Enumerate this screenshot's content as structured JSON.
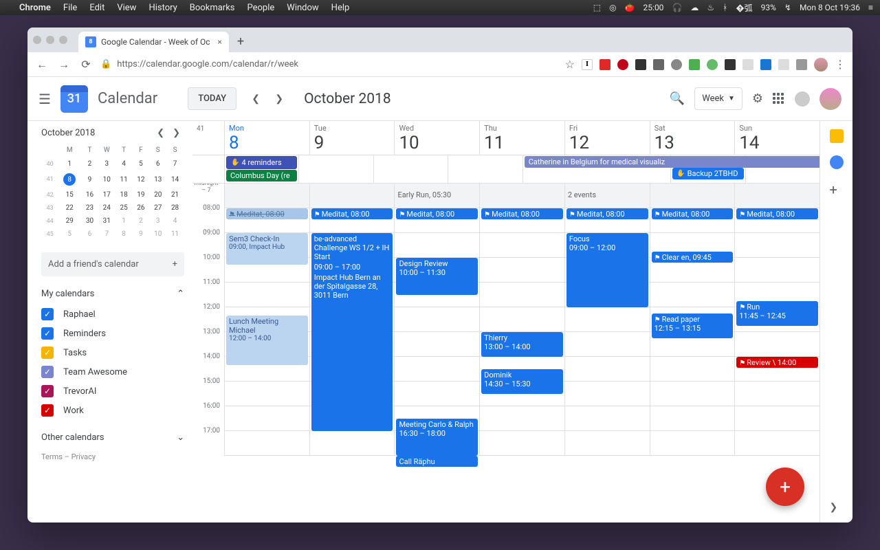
{
  "menubar": {
    "app": "Chrome",
    "items": [
      "File",
      "Edit",
      "View",
      "History",
      "Bookmarks",
      "People",
      "Window",
      "Help"
    ],
    "timer": "25:00",
    "battery": "93%",
    "clock": "Mon 8 Oct 19:36"
  },
  "tab": {
    "title": "Google Calendar - Week of Oc"
  },
  "url": "https://calendar.google.com/calendar/r/week",
  "header": {
    "logo_day": "31",
    "title": "Calendar",
    "today": "TODAY",
    "month": "October 2018",
    "view": "Week"
  },
  "minical": {
    "title": "October 2018",
    "dow": [
      "M",
      "T",
      "W",
      "T",
      "F",
      "S",
      "S"
    ],
    "weeks": [
      {
        "wk": "40",
        "days": [
          "1",
          "2",
          "3",
          "4",
          "5",
          "6",
          "7"
        ]
      },
      {
        "wk": "41",
        "days": [
          "8",
          "9",
          "10",
          "11",
          "12",
          "13",
          "14"
        ],
        "today_idx": 0
      },
      {
        "wk": "42",
        "days": [
          "15",
          "16",
          "17",
          "18",
          "19",
          "20",
          "21"
        ]
      },
      {
        "wk": "43",
        "days": [
          "22",
          "23",
          "24",
          "25",
          "26",
          "27",
          "28"
        ]
      },
      {
        "wk": "44",
        "days": [
          "29",
          "30",
          "31",
          "1",
          "2",
          "3",
          "4"
        ],
        "dim_from": 3
      },
      {
        "wk": "45",
        "days": [
          "5",
          "6",
          "7",
          "8",
          "9",
          "10",
          "11"
        ],
        "dim_from": 0
      }
    ]
  },
  "add_friend": "Add a friend's calendar",
  "my_cal_label": "My calendars",
  "other_cal_label": "Other calendars",
  "calendars": [
    {
      "name": "Raphael",
      "color": "#1a73e8"
    },
    {
      "name": "Reminders",
      "color": "#1a73e8"
    },
    {
      "name": "Tasks",
      "color": "#f4b400"
    },
    {
      "name": "Team Awesome",
      "color": "#7986cb"
    },
    {
      "name": "TrevorAI",
      "color": "#ad1457"
    },
    {
      "name": "Work",
      "color": "#d50000"
    }
  ],
  "footer": "Terms – Privacy",
  "week_num": "41",
  "days": [
    {
      "dow": "Mon",
      "num": "8",
      "today": true
    },
    {
      "dow": "Tue",
      "num": "9"
    },
    {
      "dow": "Wed",
      "num": "10"
    },
    {
      "dow": "Thu",
      "num": "11"
    },
    {
      "dow": "Fri",
      "num": "12"
    },
    {
      "dow": "Sat",
      "num": "13"
    },
    {
      "dow": "Sun",
      "num": "14"
    }
  ],
  "allday": {
    "reminders": "4 reminders",
    "columbus": "Columbus Day (re",
    "catherine": "Catherine in Belgium for medical visualiz",
    "backup": "Backup 2TBHD"
  },
  "early": {
    "ev0": "Early Run, 05:30",
    "ev1": "2 events"
  },
  "midnight": "midnight – 7",
  "hours": [
    "08:00",
    "09:00",
    "10:00",
    "11:00",
    "12:00",
    "13:00",
    "14:00",
    "15:00",
    "16:00",
    "17:00"
  ],
  "events": {
    "mon_med": "Meditat, 08:00",
    "mon_sem": "Sem3 Check-In",
    "mon_sem_t": "09:00, Impact Hub",
    "mon_lunch": "Lunch Meeting Michael",
    "mon_lunch_t": "12:00 – 14:00",
    "tue_med": "Meditat, 08:00",
    "tue_be": "be-advanced Challenge WS 1/2 + IH Start",
    "tue_be_t": "09:00 – 17:00",
    "tue_be_loc": "Impact Hub Bern an der Spitalgasse 28, 3011 Bern",
    "wed_med": "Meditat, 08:00",
    "wed_design": "Design Review",
    "wed_design_t": "10:00 – 11:30",
    "wed_carlo": "Meeting Carlo & Ralph",
    "wed_carlo_t": "16:30 – 18:00",
    "wed_raphu": "Call Räphu",
    "thu_med": "Meditat, 08:00",
    "thu_thierry": "Thierry",
    "thu_thierry_t": "13:00 – 14:00",
    "thu_dominik": "Dominik",
    "thu_dominik_t": "14:30 – 15:30",
    "fri_med": "Meditat, 08:00",
    "fri_focus": "Focus",
    "fri_focus_t": "09:00 – 12:00",
    "sat_med": "Meditat, 08:00",
    "sat_clear": "Clear en, 09:45",
    "sat_read": "Read paper",
    "sat_read_t": "12:15 – 13:15",
    "sun_med": "Meditat, 08:00",
    "sun_run": "Run",
    "sun_run_t": "11:45 – 12:45",
    "sun_review": "Review \\ 14:00"
  }
}
